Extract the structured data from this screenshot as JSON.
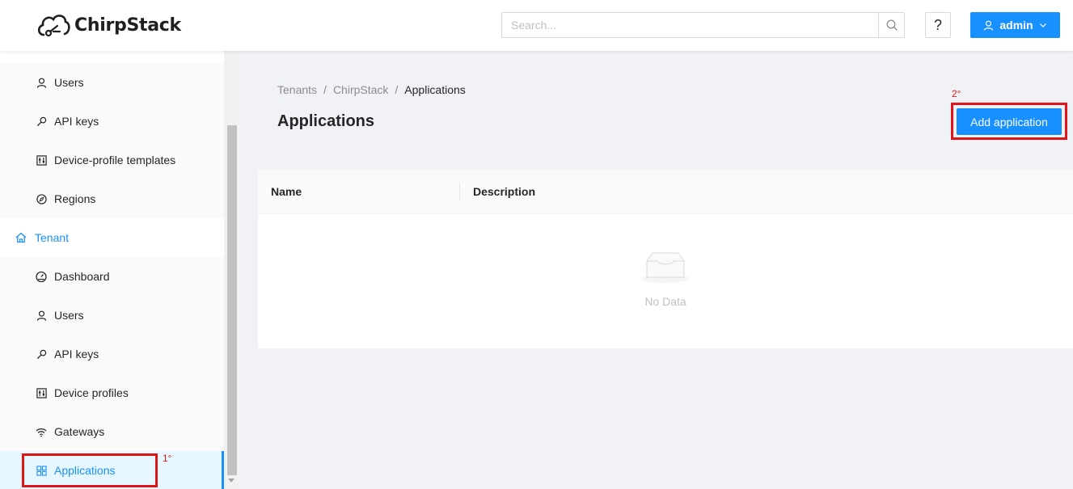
{
  "header": {
    "brand": "ChirpStack",
    "search_placeholder": "Search...",
    "help_label": "?",
    "user_label": "admin"
  },
  "sidebar": {
    "admin_items": [
      {
        "label": "Users",
        "icon": "user-icon"
      },
      {
        "label": "API keys",
        "icon": "key-icon"
      },
      {
        "label": "Device-profile templates",
        "icon": "control-icon"
      },
      {
        "label": "Regions",
        "icon": "compass-icon"
      }
    ],
    "tenant_label": "Tenant",
    "tenant_items": [
      {
        "label": "Dashboard",
        "icon": "dashboard-icon"
      },
      {
        "label": "Users",
        "icon": "user-icon"
      },
      {
        "label": "API keys",
        "icon": "key-icon"
      },
      {
        "label": "Device profiles",
        "icon": "control-icon"
      },
      {
        "label": "Gateways",
        "icon": "wifi-icon"
      },
      {
        "label": "Applications",
        "icon": "appstore-icon",
        "selected": true
      }
    ]
  },
  "breadcrumb": [
    "Tenants",
    "ChirpStack",
    "Applications"
  ],
  "page": {
    "title": "Applications",
    "add_button": "Add application"
  },
  "table": {
    "columns": [
      "Name",
      "Description"
    ],
    "empty_text": "No Data"
  },
  "annotations": {
    "first": "1°",
    "second": "2°"
  },
  "colors": {
    "primary": "#1890ff",
    "annotation": "#e01616"
  }
}
